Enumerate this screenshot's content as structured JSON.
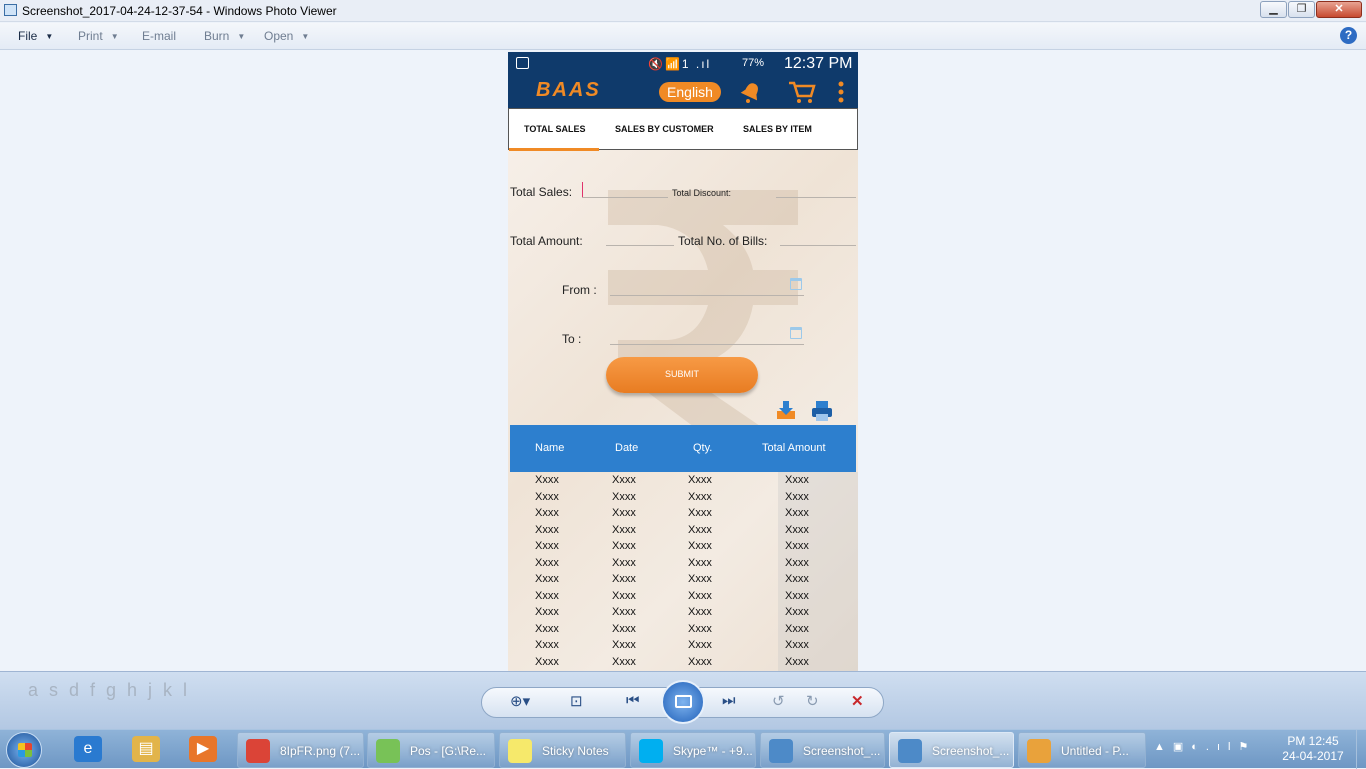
{
  "window": {
    "title": "Screenshot_2017-04-24-12-37-54 - Windows Photo Viewer",
    "controls": {
      "minimize": "▁",
      "maximize": "❐",
      "close": "✕"
    }
  },
  "menu": {
    "items": [
      {
        "label": "File",
        "has_dropdown": true
      },
      {
        "label": "Print",
        "has_dropdown": true
      },
      {
        "label": "E-mail",
        "has_dropdown": false
      },
      {
        "label": "Burn",
        "has_dropdown": true
      },
      {
        "label": "Open",
        "has_dropdown": true
      }
    ],
    "help": "?"
  },
  "phone": {
    "statusbar": {
      "icons": "🔇📶1 .ıl",
      "battery": "77%",
      "time": "12:37 PM"
    },
    "appbar": {
      "logo": "BAAS",
      "language_button": "English",
      "icons": [
        "bell-icon",
        "cart-icon",
        "more-icon"
      ]
    },
    "tabs": [
      {
        "label": "TOTAL SALES",
        "active": true
      },
      {
        "label": "SALES BY CUSTOMER",
        "active": false
      },
      {
        "label": "SALES BY ITEM",
        "active": false
      }
    ],
    "form": {
      "total_sales_label": "Total Sales:",
      "total_discount_label": "Total Discount:",
      "total_amount_label": "Total Amount:",
      "total_bills_label": "Total No. of Bills:",
      "from_label": "From :",
      "to_label": "To :",
      "submit_label": "SUBMIT"
    },
    "table": {
      "headers": [
        "Name",
        "Date",
        "Qty.",
        "Total Amount"
      ],
      "rows": [
        [
          "Xxxx",
          "Xxxx",
          "Xxxx",
          "Xxxx"
        ],
        [
          "Xxxx",
          "Xxxx",
          "Xxxx",
          "Xxxx"
        ],
        [
          "Xxxx",
          "Xxxx",
          "Xxxx",
          "Xxxx"
        ],
        [
          "Xxxx",
          "Xxxx",
          "Xxxx",
          "Xxxx"
        ],
        [
          "Xxxx",
          "Xxxx",
          "Xxxx",
          "Xxxx"
        ],
        [
          "Xxxx",
          "Xxxx",
          "Xxxx",
          "Xxxx"
        ],
        [
          "Xxxx",
          "Xxxx",
          "Xxxx",
          "Xxxx"
        ],
        [
          "Xxxx",
          "Xxxx",
          "Xxxx",
          "Xxxx"
        ],
        [
          "Xxxx",
          "Xxxx",
          "Xxxx",
          "Xxxx"
        ],
        [
          "Xxxx",
          "Xxxx",
          "Xxxx",
          "Xxxx"
        ],
        [
          "Xxxx",
          "Xxxx",
          "Xxxx",
          "Xxxx"
        ],
        [
          "Xxxx",
          "Xxxx",
          "Xxxx",
          "Xxxx"
        ]
      ]
    }
  },
  "viewer_toolbar": {
    "background_keys": "asdfghjkl",
    "buttons": [
      "zoom-icon",
      "actual-size-icon",
      "previous-icon",
      "slideshow-icon",
      "next-icon",
      "rotate-ccw-icon",
      "rotate-cw-icon",
      "delete-icon"
    ]
  },
  "taskbar": {
    "pinned": [
      "ie-icon",
      "explorer-icon",
      "media-player-icon"
    ],
    "tasks": [
      {
        "label": "8IpFR.png (7...",
        "color": "#db4437",
        "active": false
      },
      {
        "label": "Pos - [G:\\Re...",
        "color": "#78c257",
        "active": false
      },
      {
        "label": "Sticky Notes",
        "color": "#f6e96b",
        "active": false
      },
      {
        "label": "Skype™ - +9...",
        "color": "#00aff0",
        "active": false
      },
      {
        "label": "Screenshot_...",
        "color": "#4d8ac8",
        "active": false
      },
      {
        "label": "Screenshot_...",
        "color": "#4d8ac8",
        "active": true
      },
      {
        "label": "Untitled - P...",
        "color": "#e9a23b",
        "active": false
      }
    ],
    "clock": {
      "time": "PM 12:45",
      "date": "24-04-2017"
    }
  },
  "colors": {
    "accent_orange": "#f08a25",
    "app_navy": "#0f3a6b",
    "table_header": "#2d7fce"
  }
}
